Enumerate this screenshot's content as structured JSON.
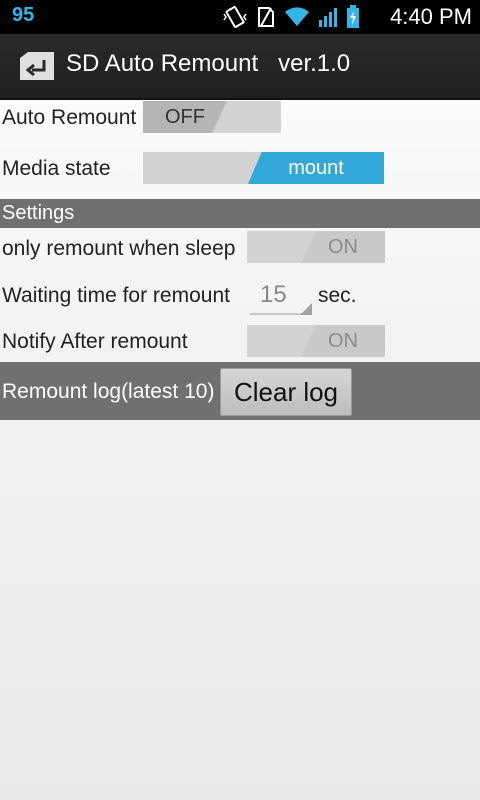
{
  "statusbar": {
    "battery_level_text": "95",
    "time": "4:40 PM",
    "icons": [
      "vibrate-icon",
      "no-sim-icon",
      "wifi-icon",
      "signal-icon",
      "battery-charging-icon"
    ]
  },
  "actionbar": {
    "title": "SD Auto Remount   ver.1.0",
    "icon": "app-icon"
  },
  "main": {
    "auto_remount": {
      "label": "Auto Remount",
      "state": "OFF"
    },
    "media_state": {
      "label": "Media state",
      "value": "mount"
    },
    "settings_header": "Settings",
    "only_remount_sleep": {
      "label": "only remount when sleep",
      "state": "ON"
    },
    "waiting_time": {
      "label": "Waiting time for remount",
      "value": "15",
      "unit": "sec."
    },
    "notify_after": {
      "label": "Notify After remount",
      "state": "ON"
    },
    "remount_log": {
      "label": "Remount log(latest 10)",
      "clear_button": "Clear log"
    }
  },
  "colors": {
    "accent": "#33a8d8",
    "section_bg": "#707070",
    "statusbar_number": "#33b5e5"
  }
}
